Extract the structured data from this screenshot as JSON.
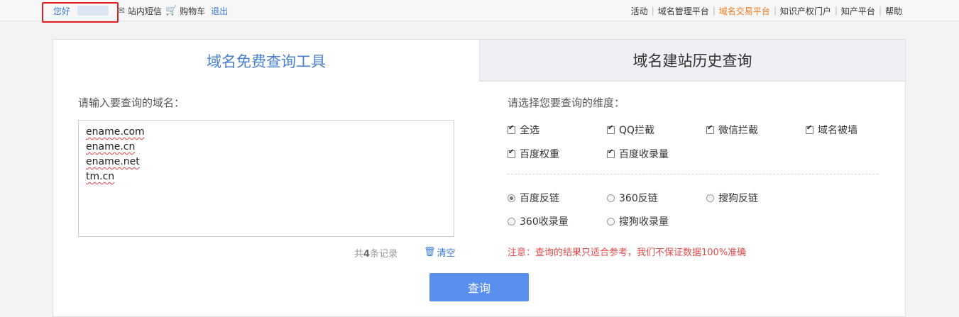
{
  "topbar": {
    "hello": "您好",
    "messages": "站内短信",
    "cart": "购物车",
    "logout": "退出",
    "nav": [
      {
        "label": "活动",
        "active": false
      },
      {
        "label": "域名管理平台",
        "active": false
      },
      {
        "label": "域名交易平台",
        "active": true
      },
      {
        "label": "知识产权门户",
        "active": false
      },
      {
        "label": "知产平台",
        "active": false
      },
      {
        "label": "帮助",
        "active": false
      }
    ]
  },
  "tabs": {
    "free_query": "域名免费查询工具",
    "history_query": "域名建站历史查询"
  },
  "left": {
    "label": "请输入要查询的域名：",
    "domains": [
      "ename.com",
      "ename.cn",
      "ename.net",
      "tm.cn"
    ],
    "count_prefix": "共",
    "count": "4",
    "count_suffix": "条记录",
    "clear": "清空"
  },
  "right": {
    "label": "请选择您要查询的维度：",
    "checkboxes": [
      "全选",
      "QQ拦截",
      "微信拦截",
      "域名被墙",
      "百度权重",
      "百度收录量"
    ],
    "radios": [
      "百度反链",
      "360反链",
      "搜狗反链",
      "360收录量",
      "搜狗收录量"
    ],
    "selected_radio": "百度反链",
    "notice": "注意：查询的结果只适合参考，我们不保证数据100%准确"
  },
  "query_button": "查询",
  "colors": {
    "accent": "#5a8ff0",
    "active_nav": "#f07b1c",
    "notice": "#e84a4a"
  }
}
